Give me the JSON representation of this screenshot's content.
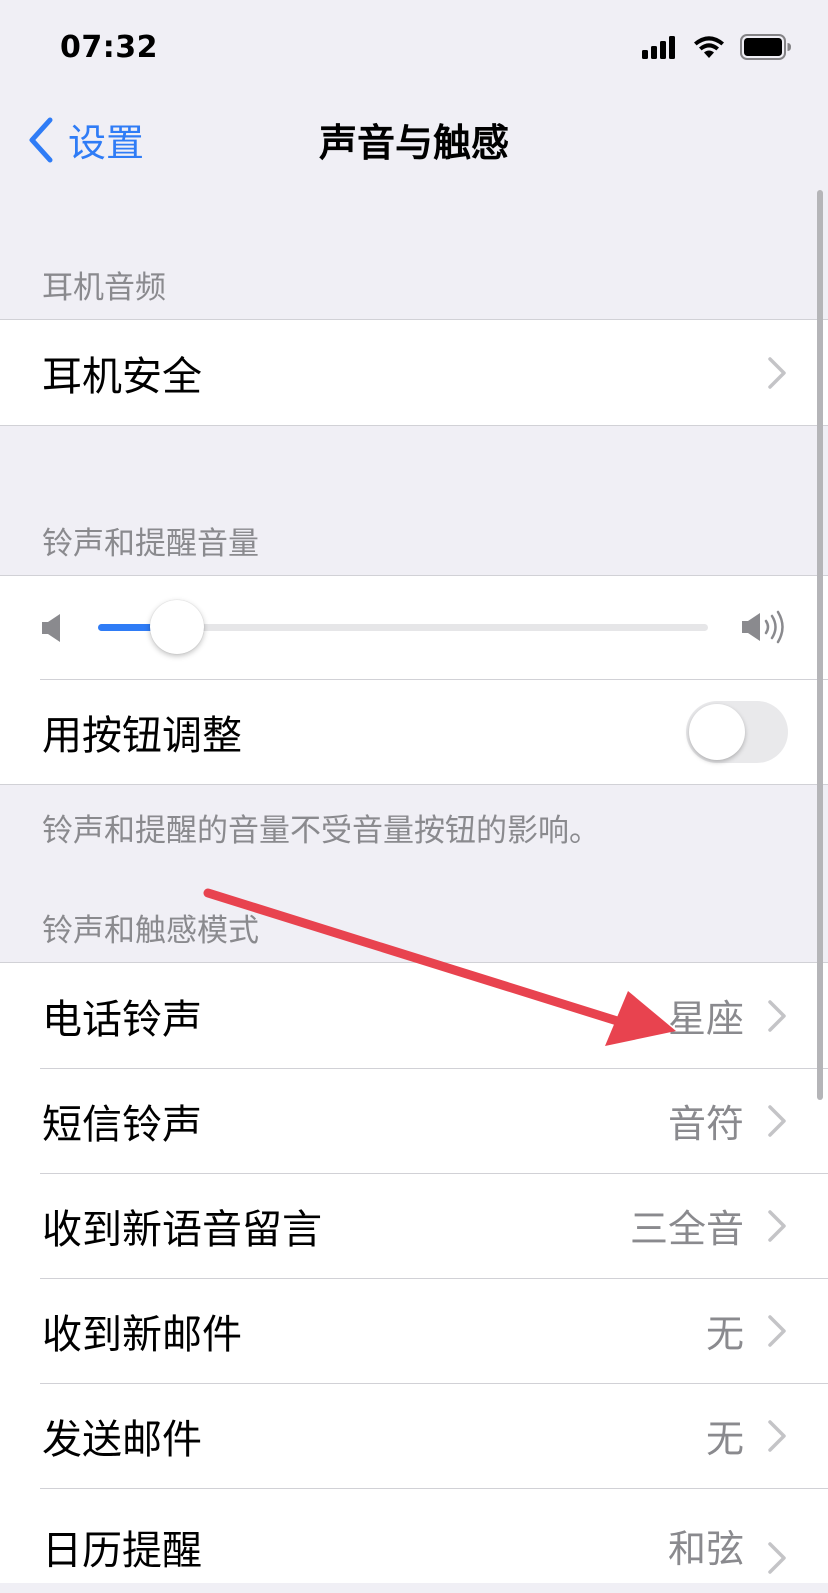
{
  "status_bar": {
    "time": "07:32",
    "icons": [
      "cellular-signal-icon",
      "wifi-icon",
      "battery-icon"
    ]
  },
  "nav": {
    "back_label": "设置",
    "title": "声音与触感"
  },
  "sections": {
    "headphone_audio": {
      "header": "耳机音频",
      "rows": [
        {
          "label": "耳机安全"
        }
      ]
    },
    "ringer_alerts": {
      "header": "铃声和提醒音量",
      "slider_level": 0.13,
      "change_with_buttons_label": "用按钮调整",
      "change_with_buttons_on": false,
      "footer": "铃声和提醒的音量不受音量按钮的影响。"
    },
    "sounds_haptics": {
      "header": "铃声和触感模式",
      "rows": [
        {
          "label": "电话铃声",
          "value": "星座"
        },
        {
          "label": "短信铃声",
          "value": "音符"
        },
        {
          "label": "收到新语音留言",
          "value": "三全音"
        },
        {
          "label": "收到新邮件",
          "value": "无"
        },
        {
          "label": "发送邮件",
          "value": "无"
        },
        {
          "label": "日历提醒",
          "value": "和弦"
        }
      ]
    }
  },
  "colors": {
    "accent": "#2f7cf6",
    "background": "#f0eff5",
    "secondary_text": "#8a8a8e",
    "annotation_arrow": "#e8434f"
  }
}
